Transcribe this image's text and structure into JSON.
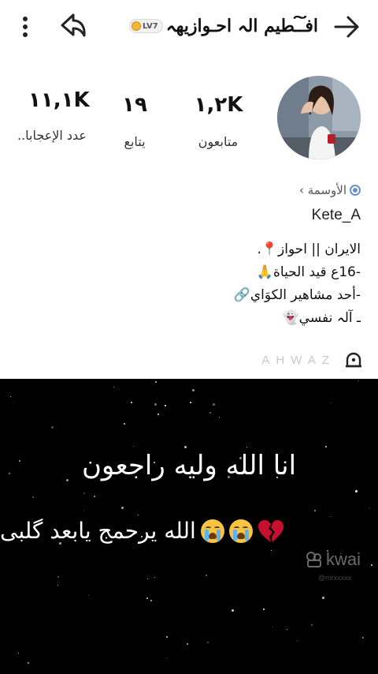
{
  "header": {
    "title": "افـ͠ـطيم الہ ‌اﺣـوازيهہ",
    "level_badge": "LV7",
    "back_icon": "arrow-right-icon",
    "share_icon": "share-arrow-icon",
    "more_icon": "vertical-dots-icon"
  },
  "stats": {
    "followers": {
      "value": "١,٢K",
      "label": "متابعون"
    },
    "following": {
      "value": "١٩",
      "label": "يتابع"
    },
    "likes": {
      "value": "١١,١K",
      "label": "عدد الإعجابا.."
    }
  },
  "profile": {
    "badges_label": "الأوسمة ›",
    "username": "Kete_A",
    "bio": [
      "الايران || احواز📍.",
      "-16ع قيد الحياة🙏",
      "-أحد مشاهير الكوَاي🔗",
      "ـ آلہ نفسي👻"
    ],
    "region": "AHWAZ"
  },
  "video": {
    "caption_line1": "انا الله وليه راجعون",
    "caption_line2": "الله يرحمج يابعد گلبى",
    "watermark": "kwai",
    "watermark_sub": "@mrxxxxx",
    "accent": "#c8102e"
  }
}
